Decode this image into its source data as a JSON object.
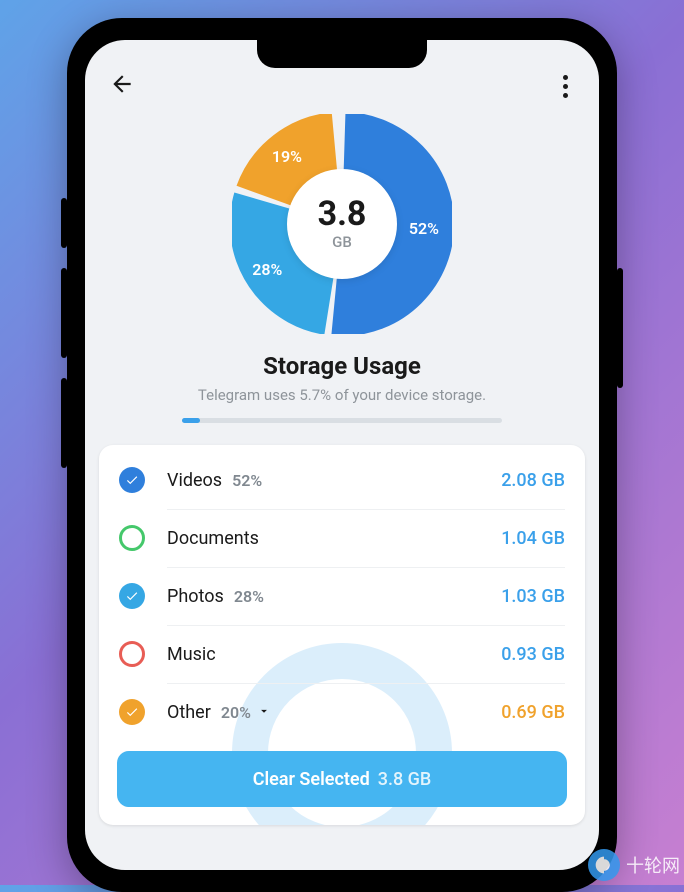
{
  "colors": {
    "blue": "#2f7fdc",
    "lightblue": "#35a7e4",
    "orange": "#f0a22c",
    "green": "#45c86b",
    "red": "#e85d55",
    "accentText": "#3aa0ea"
  },
  "header": {
    "title": "Storage Usage",
    "subtitle": "Telegram uses 5.7% of your device storage.",
    "progress_percent": 5.7
  },
  "chart_data": {
    "type": "pie",
    "title": "Storage Usage",
    "center_value": "3.8",
    "center_unit": "GB",
    "series": [
      {
        "name": "Videos",
        "value": 52,
        "label": "52%",
        "color": "#2f7fdc"
      },
      {
        "name": "Photos",
        "value": 28,
        "label": "28%",
        "color": "#35a7e4"
      },
      {
        "name": "Other",
        "value": 19,
        "label": "19%",
        "color": "#f0a22c"
      }
    ]
  },
  "items": [
    {
      "label": "Videos",
      "percent": "52%",
      "size": "2.08 GB",
      "checked": true,
      "color": "#2f7fdc",
      "size_color": "#3aa0ea",
      "expandable": false
    },
    {
      "label": "Documents",
      "percent": "",
      "size": "1.04 GB",
      "checked": false,
      "color": "#45c86b",
      "size_color": "#3aa0ea",
      "expandable": false
    },
    {
      "label": "Photos",
      "percent": "28%",
      "size": "1.03 GB",
      "checked": true,
      "color": "#35a7e4",
      "size_color": "#3aa0ea",
      "expandable": false
    },
    {
      "label": "Music",
      "percent": "",
      "size": "0.93 GB",
      "checked": false,
      "color": "#e85d55",
      "size_color": "#3aa0ea",
      "expandable": false
    },
    {
      "label": "Other",
      "percent": "20%",
      "size": "0.69 GB",
      "checked": true,
      "color": "#f0a22c",
      "size_color": "#f0a22c",
      "expandable": true
    }
  ],
  "clear_button": {
    "label": "Clear Selected",
    "amount": "3.8 GB"
  },
  "watermark": "十轮网"
}
